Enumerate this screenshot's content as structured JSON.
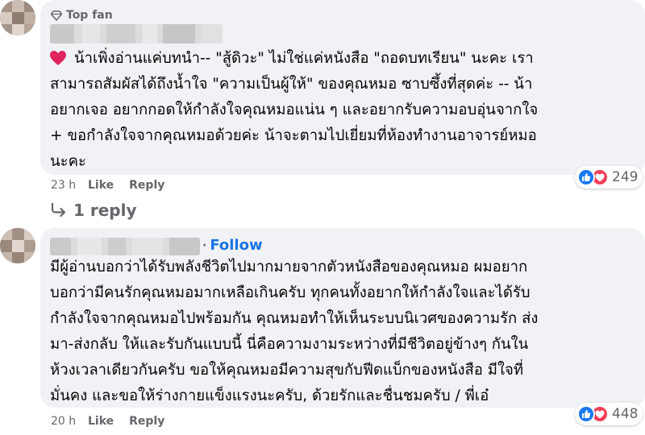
{
  "colors": {
    "accent": "#1b74e4",
    "bubble": "#f0f2f5",
    "muted": "#65676b",
    "like": "#1877f2",
    "love": "#f33e58"
  },
  "comments": [
    {
      "badge": "Top fan",
      "badge_icon": "diamond-icon",
      "author_blurred": true,
      "lead_icon": "red-heart-emoji",
      "text": "น้าเพิ่งอ่านแค่บทนำ-- \"สู้ดิวะ\" ไม่ใช่แค่หนังสือ \"ถอดบทเรียน\" นะคะ เรา\nสามารถสัมผัสได้ถึงน้ำใจ \"ความเป็นผู้ให้\" ของคุณหมอ ซาบซึ้งที่สุดค่ะ -- น้า\nอยากเจอ อยากกอดให้กำลังใจคุณหมอแน่น ๆ และอยากรับความอบอุ่นจากใจ\n+ ขอกำลังใจจากคุณหมอด้วยค่ะ น้าจะตามไปเยี่ยมที่ห้องทำงานอาจารย์หมอ\nนะคะ",
      "time": "23 h",
      "like_label": "Like",
      "reply_label": "Reply",
      "reaction_count": "249",
      "replies_label": "1 reply"
    },
    {
      "author_blurred": true,
      "follow_label": "Follow",
      "text": "มีผู้อ่านบอกว่าได้รับพลังชีวิตไปมากมายจากตัวหนังสือของคุณหมอ ผมอยาก\nบอกว่ามีคนรักคุณหมอมากเหลือเกินครับ ทุกคนทั้งอยากให้กำลังใจและได้รับ\nกำลังใจจากคุณหมอไปพร้อมกัน คุณหมอทำให้เห็นระบบนิเวศของความรัก ส่ง\nมา-ส่งกลับ ให้และรับกันแบบนี้ นี่คือความงามระหว่างที่มีชีวิตอยู่ข้างๆ กันใน\nห้วงเวลาเดียวกันครับ ขอให้คุณหมอมีความสุขกับฟีดแบ็กของหนังสือ มีใจที่\nมั่นคง และขอให้ร่างกายแข็งแรงนะครับ, ด้วยรักและชื่นชมครับ / พี่เอ๋",
      "time": "20 h",
      "like_label": "Like",
      "reply_label": "Reply",
      "reaction_count": "448"
    }
  ]
}
